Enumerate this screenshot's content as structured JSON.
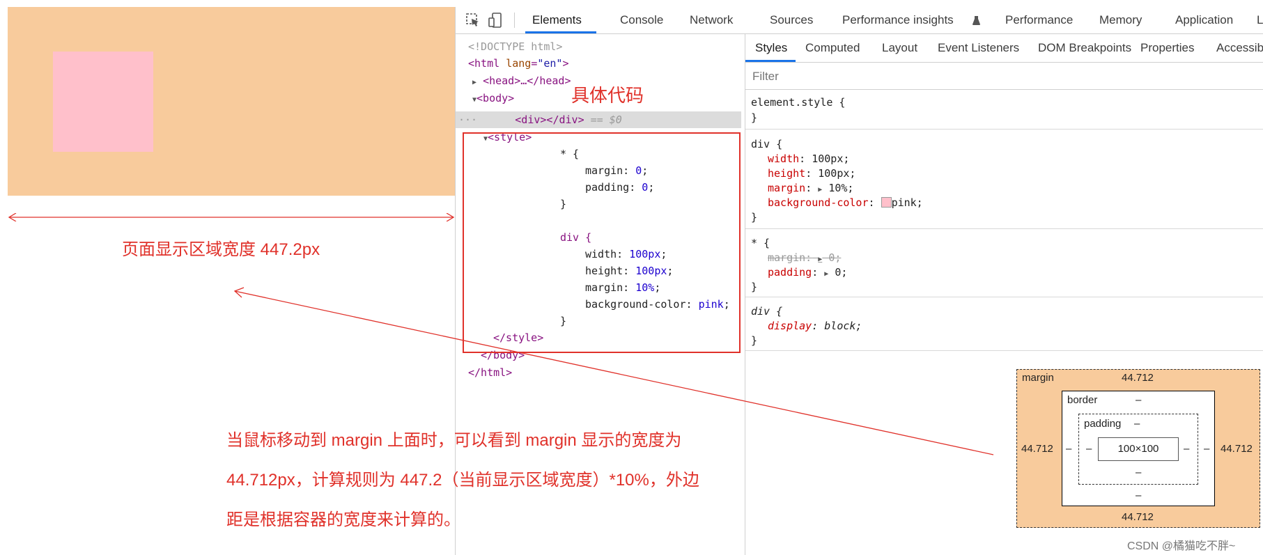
{
  "preview": {
    "width_label": "页面显示区域宽度 447.2px"
  },
  "annotation": {
    "code_label": "具体代码",
    "explain_lines": [
      "当鼠标移动到 margin 上面时，可以看到 margin 显示的宽度为",
      "44.712px，计算规则为 447.2（当前显示区域宽度）*10%，外边",
      "距是根据容器的宽度来计算的。"
    ]
  },
  "devtools": {
    "tabs": [
      "Elements",
      "Console",
      "Network",
      "Sources",
      "Performance insights",
      "Performance",
      "Memory",
      "Application",
      "Lighthous"
    ],
    "active_tab": "Elements",
    "dom": {
      "doctype": "<!DOCTYPE html>",
      "html_open_tag": "html",
      "lang_attr": "lang",
      "lang_val": "\"en\"",
      "head": "<head>…</head>",
      "body_open": "<body>",
      "div": "<div></div>",
      "div_ref": "== $0",
      "style_open": "<style>",
      "css_lines": {
        "star_sel": "* {",
        "margin_prop": "margin: ",
        "margin_val": "0",
        "semi": ";",
        "padding_prop": "padding: ",
        "padding_val": "0",
        "close": "}",
        "div_sel": "div {",
        "width_prop": "width: ",
        "width_val": "100px",
        "height_prop": "height: ",
        "height_val": "100px",
        "margin2_prop": "margin: ",
        "margin2_val": "10%",
        "bg_prop": "background-color: ",
        "bg_val": "pink"
      },
      "style_close": "</style>",
      "body_close": "</body>",
      "html_close": "</html>"
    },
    "styles_tabs": [
      "Styles",
      "Computed",
      "Layout",
      "Event Listeners",
      "DOM Breakpoints",
      "Properties",
      "Accessib"
    ],
    "filter_placeholder": "Filter",
    "rules": {
      "element_style": "element.style {",
      "brace_close": "}",
      "div_sel": "div {",
      "width": "width",
      "width_val": "100px;",
      "height": "height",
      "height_val": "100px;",
      "margin": "margin",
      "margin_val": "10%;",
      "bg": "background-color",
      "bg_val": "pink;",
      "star_sel": "* {",
      "star_margin": "margin:",
      "star_margin_val": "0;",
      "star_padding": "padding",
      "star_padding_val": "0;",
      "ua_div_sel": "div {",
      "display": "display",
      "display_val": "block;"
    },
    "box_model": {
      "margin_label": "margin",
      "margin_top": "44.712",
      "margin_bottom": "44.712",
      "margin_left": "44.712",
      "margin_right": "44.712",
      "border_label": "border",
      "dash": "–",
      "padding_label": "padding",
      "content": "100×100"
    }
  },
  "watermark": "CSDN @橘猫吃不胖~",
  "colors": {
    "preview_bg": "#f8cb9c",
    "pink": "#ffc0cb",
    "annotation_red": "#e0312a",
    "tab_accent": "#1a73e8"
  }
}
